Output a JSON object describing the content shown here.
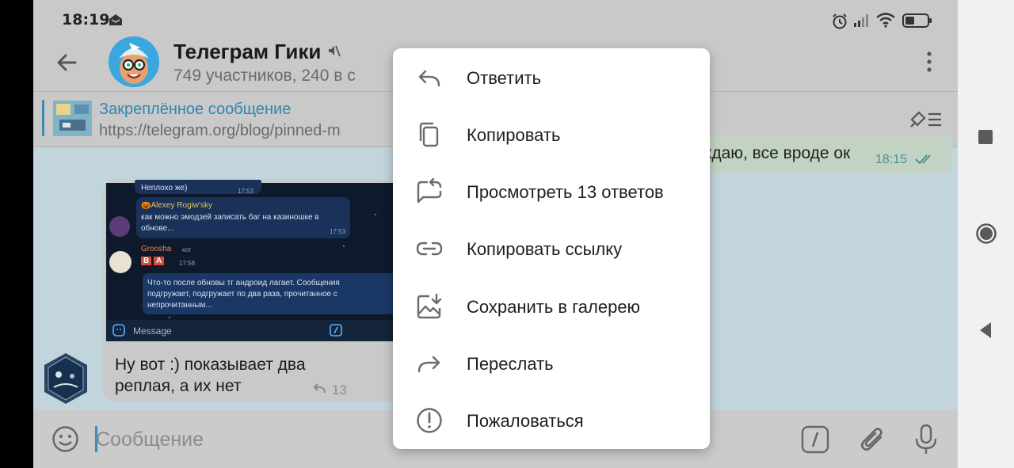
{
  "status_bar": {
    "time": "18:19"
  },
  "header": {
    "title": "Телеграм Гики",
    "subtitle": "749 участников, 240 в с"
  },
  "pinned": {
    "title": "Закреплённое сообщение",
    "text": "https://telegram.org/blog/pinned-m"
  },
  "own_message": {
    "text": "верждаю, все вроде ок",
    "time": "18:15"
  },
  "incoming_message": {
    "text": "Ну вот :) показывает два реплая, а их нет",
    "reply_count": "13",
    "screenshot": {
      "line1": "Неплохо же)",
      "line1_time": "17:53",
      "sender2": "🎃Alexey Rogiw'sky",
      "text2a": "как можно эмодзей записать баг на казиношке в",
      "text2b": "обнове...",
      "time2": "17:53",
      "sender3": "Groosha",
      "tag3": "кот",
      "badge_b": "B",
      "badge_a": "A",
      "time3": "17:56",
      "text4a": "Что-то после обновы тг андроид лагает. Сообщения",
      "text4b": "подгружает, подгружает по два раза, прочитанное с",
      "text4c": "непрочитанным...",
      "input": "Message"
    }
  },
  "input_bar": {
    "placeholder": "Сообщение"
  },
  "context_menu": {
    "items": [
      {
        "label": "Ответить",
        "icon": "reply-icon"
      },
      {
        "label": "Копировать",
        "icon": "copy-icon"
      },
      {
        "label": "Просмотреть 13 ответов",
        "icon": "view-replies-icon"
      },
      {
        "label": "Копировать ссылку",
        "icon": "link-icon"
      },
      {
        "label": "Сохранить в галерею",
        "icon": "save-gallery-icon"
      },
      {
        "label": "Переслать",
        "icon": "forward-icon"
      },
      {
        "label": "Пожаловаться",
        "icon": "report-icon"
      }
    ]
  },
  "colors": {
    "accent": "#2f86b3",
    "menu_bg": "#ffffff",
    "dim_bg": "#c2d5dc"
  }
}
